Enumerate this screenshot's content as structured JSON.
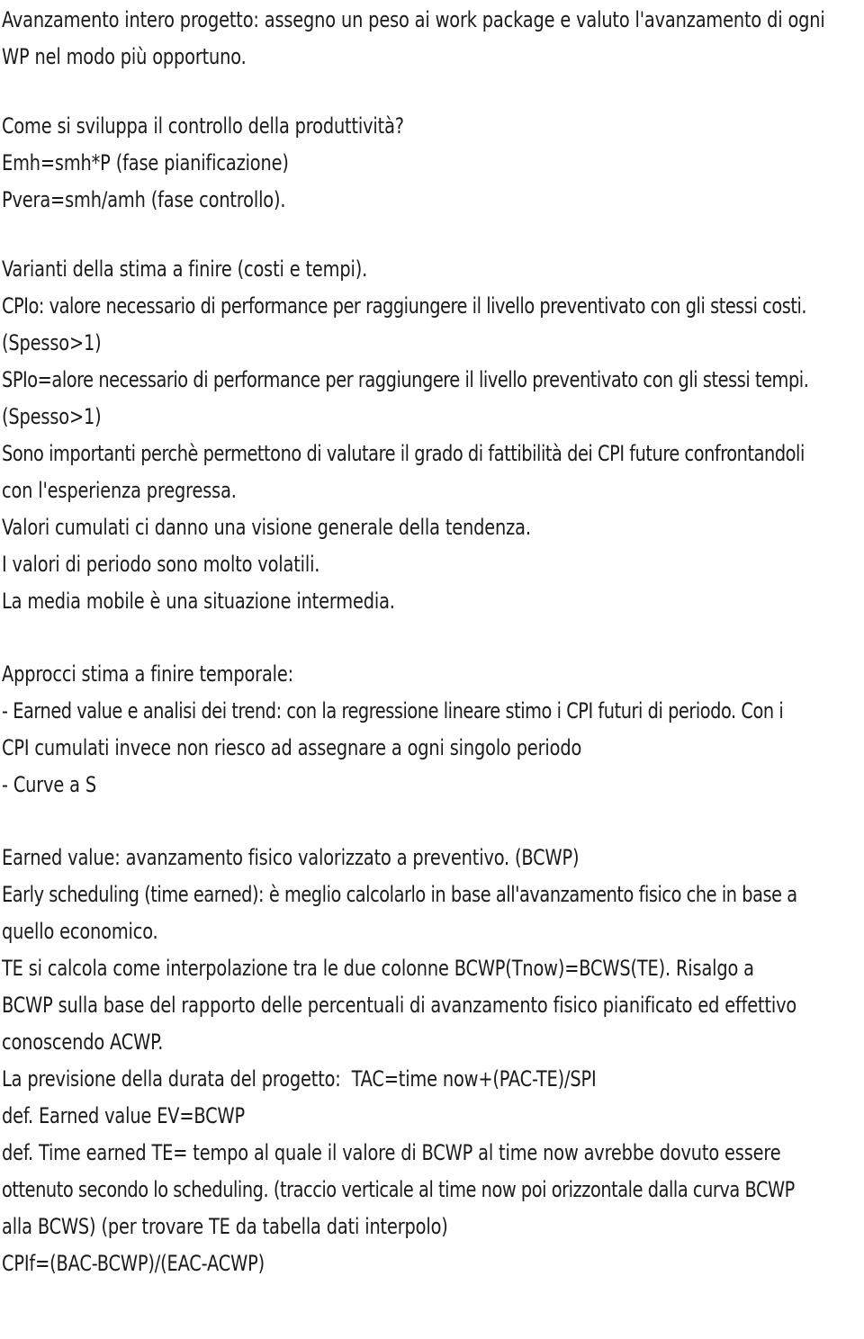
{
  "document": {
    "language": "it",
    "text_color": "#1a1a1a",
    "background_color": "#ffffff",
    "blocks": [
      {
        "id": "block-avanzamento",
        "lines": [
          "Avanzamento intero progetto: assegno un peso ai work package e valuto l'avanzamento di ogni",
          "WP nel modo più opportuno."
        ]
      },
      {
        "id": "block-produttivita",
        "lines": [
          "Come si sviluppa il controllo della produttività?",
          "Emh=smh*P (fase pianificazione)",
          "Pvera=smh/amh (fase controllo)."
        ]
      },
      {
        "id": "block-varianti",
        "lines": [
          "Varianti della stima a finire (costi e tempi).",
          "CPIo: valore necessario di performance per raggiungere il livello preventivato con gli stessi costi.",
          "(Spesso>1)",
          "SPIo=alore necessario di performance per raggiungere il livello preventivato con gli stessi tempi.",
          "(Spesso>1)",
          "Sono importanti perchè permettono di valutare il grado di fattibilità dei CPI future confrontandoli",
          "con l'esperienza pregressa.",
          "Valori cumulati ci danno una visione generale della tendenza.",
          "I valori di periodo sono molto volatili.",
          "La media mobile è una situazione intermedia."
        ]
      },
      {
        "id": "block-approcci",
        "lines": [
          "Approcci stima a finire temporale:",
          "- Earned value e analisi dei trend: con la regressione lineare stimo i CPI futuri di periodo. Con i",
          "CPI cumulati invece non riesco ad assegnare a ogni singolo periodo",
          "- Curve a S"
        ]
      },
      {
        "id": "block-earned-value",
        "lines": [
          "Earned value: avanzamento fisico valorizzato a preventivo. (BCWP)",
          "Early scheduling (time earned): è meglio calcolarlo in base all'avanzamento fisico che in base a",
          "quello economico.",
          "TE si calcola come interpolazione tra le due colonne BCWP(Tnow)=BCWS(TE). Risalgo a",
          "BCWP sulla base del rapporto delle percentuali di avanzamento fisico pianificato ed effettivo",
          "conoscendo ACWP.",
          "La previsione della durata del progetto:  TAC=time now+(PAC-TE)/SPI",
          "def. Earned value EV=BCWP",
          "def. Time earned TE= tempo al quale il valore di BCWP al time now avrebbe dovuto essere",
          "ottenuto secondo lo scheduling. (traccio verticale al time now poi orizzontale dalla curva BCWP",
          "alla BCWS) (per trovare TE da tabella dati interpolo)",
          "CPIf=(BAC-BCWP)/(EAC-ACWP)"
        ]
      }
    ]
  }
}
